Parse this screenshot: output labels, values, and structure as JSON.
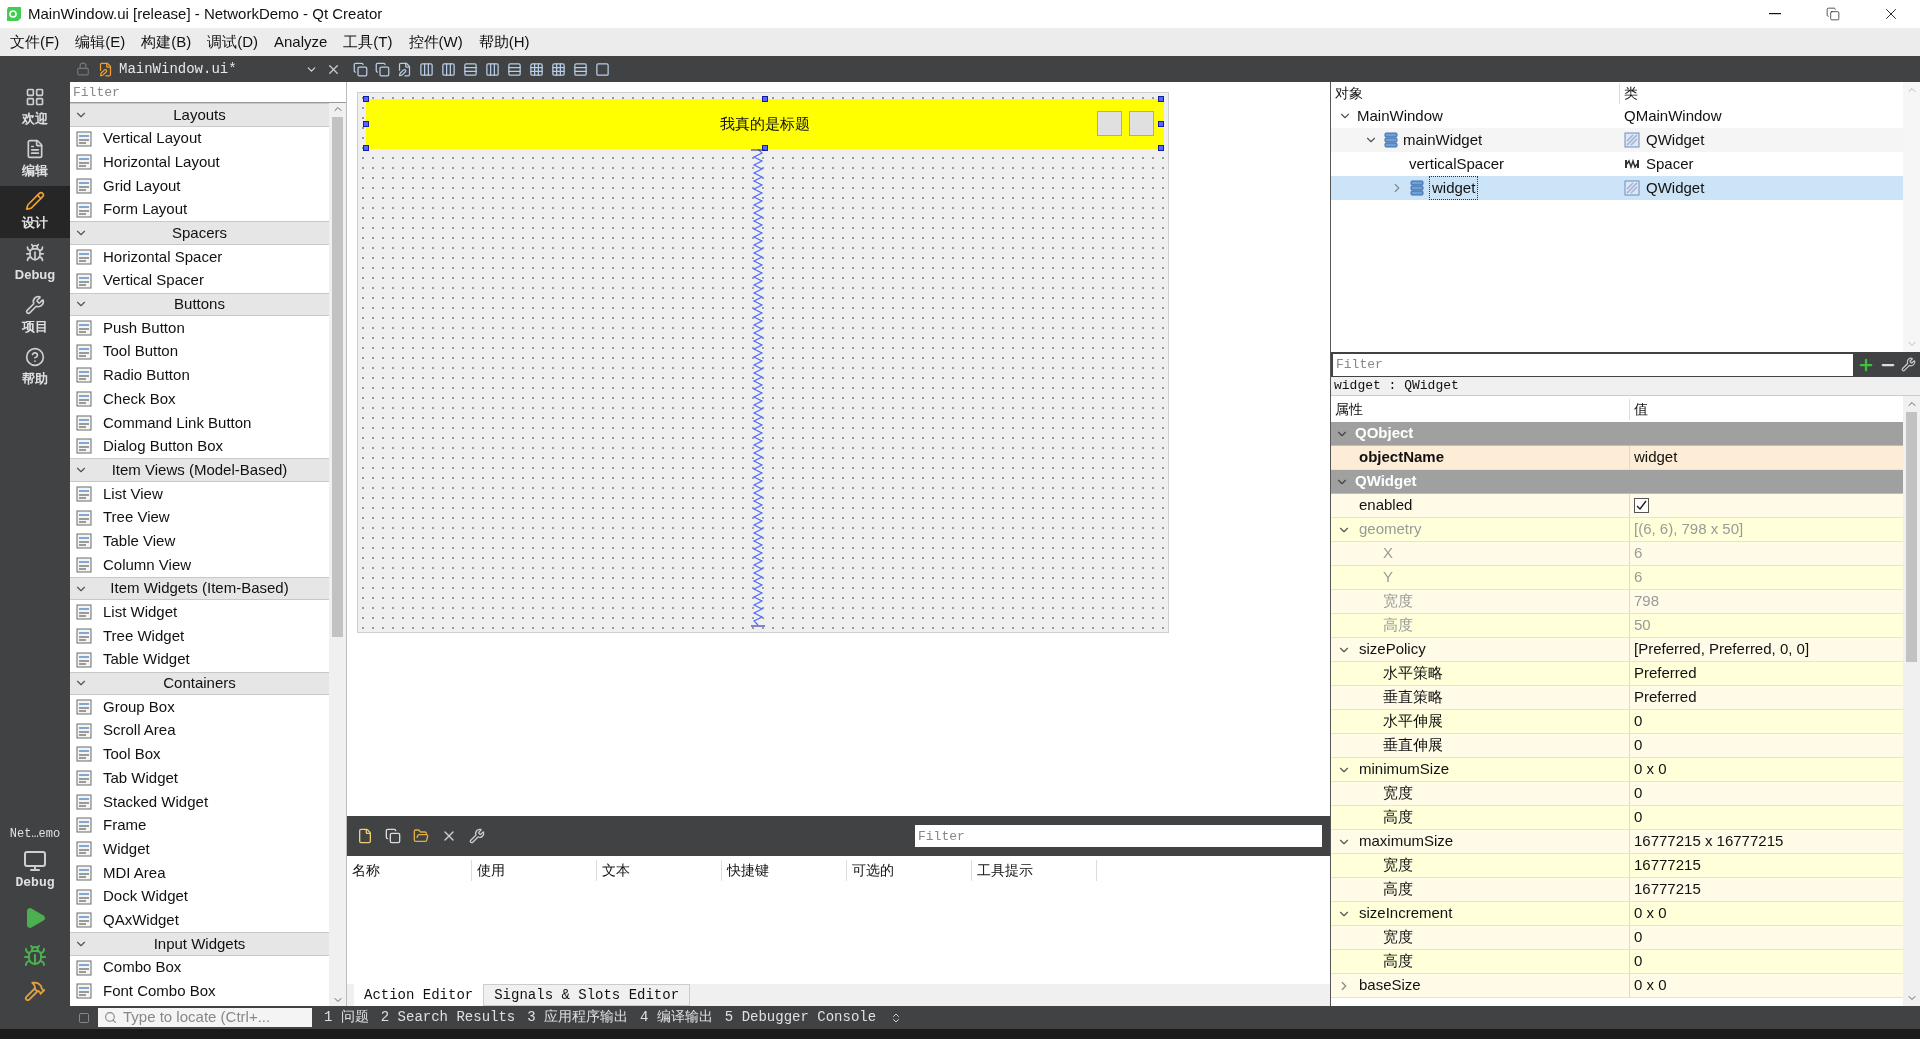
{
  "window": {
    "title": "MainWindow.ui [release] - NetworkDemo - Qt Creator"
  },
  "menu": [
    "文件(F)",
    "编辑(E)",
    "构建(B)",
    "调试(D)",
    "Analyze",
    "工具(T)",
    "控件(W)",
    "帮助(H)"
  ],
  "editor_tab": {
    "label": "MainWindow.ui*"
  },
  "modes": [
    {
      "label": "欢迎",
      "selected": false
    },
    {
      "label": "编辑",
      "selected": false
    },
    {
      "label": "设计",
      "selected": true
    },
    {
      "label": "Debug",
      "selected": false
    },
    {
      "label": "项目",
      "selected": false
    },
    {
      "label": "帮助",
      "selected": false
    }
  ],
  "run_target": {
    "project": "Net…emo",
    "config": "Debug"
  },
  "widget_box": {
    "filter_placeholder": "Filter",
    "categories": [
      {
        "name": "Layouts",
        "expanded": true,
        "items": [
          "Vertical Layout",
          "Horizontal Layout",
          "Grid Layout",
          "Form Layout"
        ]
      },
      {
        "name": "Spacers",
        "expanded": true,
        "items": [
          "Horizontal Spacer",
          "Vertical Spacer"
        ]
      },
      {
        "name": "Buttons",
        "expanded": true,
        "items": [
          "Push Button",
          "Tool Button",
          "Radio Button",
          "Check Box",
          "Command Link Button",
          "Dialog Button Box"
        ]
      },
      {
        "name": "Item Views (Model-Based)",
        "expanded": true,
        "items": [
          "List View",
          "Tree View",
          "Table View",
          "Column View"
        ]
      },
      {
        "name": "Item Widgets (Item-Based)",
        "expanded": true,
        "items": [
          "List Widget",
          "Tree Widget",
          "Table Widget"
        ]
      },
      {
        "name": "Containers",
        "expanded": true,
        "items": [
          "Group Box",
          "Scroll Area",
          "Tool Box",
          "Tab Widget",
          "Stacked Widget",
          "Frame",
          "Widget",
          "MDI Area",
          "Dock Widget",
          "QAxWidget"
        ]
      },
      {
        "name": "Input Widgets",
        "expanded": true,
        "items": [
          "Combo Box",
          "Font Combo Box"
        ]
      }
    ]
  },
  "form": {
    "title": "我真的是标题"
  },
  "action_editor": {
    "filter_placeholder": "Filter",
    "columns": [
      "名称",
      "使用",
      "文本",
      "快捷键",
      "可选的",
      "工具提示"
    ],
    "tabs": [
      {
        "label": "Action Editor",
        "selected": true
      },
      {
        "label": "Signals & Slots Editor",
        "selected": false
      }
    ]
  },
  "object_inspector": {
    "columns": [
      "对象",
      "类"
    ],
    "tree": [
      {
        "name": "MainWindow",
        "class": "QMainWindow",
        "expanded": true,
        "selected": false,
        "children": [
          {
            "name": "mainWidget",
            "class": "QWidget",
            "kind": "layout-widget",
            "expanded": true,
            "selected": false,
            "children": [
              {
                "name": "verticalSpacer",
                "class": "Spacer",
                "kind": "spacer",
                "selected": false
              },
              {
                "name": "widget",
                "class": "QWidget",
                "kind": "layout-widget",
                "expanded": false,
                "selected": true
              }
            ]
          }
        ]
      }
    ]
  },
  "property_editor": {
    "filter_placeholder": "Filter",
    "object_label": "widget : QWidget",
    "columns": [
      "属性",
      "值"
    ],
    "groups": [
      {
        "name": "QObject",
        "expanded": true,
        "properties": [
          {
            "name": "objectName",
            "value": "widget",
            "modified": true
          }
        ]
      },
      {
        "name": "QWidget",
        "expanded": true,
        "properties": [
          {
            "name": "enabled",
            "kind": "checkbox",
            "checked": true
          },
          {
            "name": "geometry",
            "value": "[(6, 6), 798 x 50]",
            "disabled": true,
            "expanded": true,
            "children": [
              {
                "name": "X",
                "value": "6",
                "disabled": true
              },
              {
                "name": "Y",
                "value": "6",
                "disabled": true
              },
              {
                "name": "宽度",
                "value": "798",
                "disabled": true
              },
              {
                "name": "高度",
                "value": "50",
                "disabled": true
              }
            ]
          },
          {
            "name": "sizePolicy",
            "value": "[Preferred, Preferred, 0, 0]",
            "expanded": true,
            "children": [
              {
                "name": "水平策略",
                "value": "Preferred"
              },
              {
                "name": "垂直策略",
                "value": "Preferred"
              },
              {
                "name": "水平伸展",
                "value": "0"
              },
              {
                "name": "垂直伸展",
                "value": "0"
              }
            ]
          },
          {
            "name": "minimumSize",
            "value": "0 x 0",
            "expanded": true,
            "children": [
              {
                "name": "宽度",
                "value": "0"
              },
              {
                "name": "高度",
                "value": "0"
              }
            ]
          },
          {
            "name": "maximumSize",
            "value": "16777215 x 16777215",
            "expanded": true,
            "children": [
              {
                "name": "宽度",
                "value": "16777215"
              },
              {
                "name": "高度",
                "value": "16777215"
              }
            ]
          },
          {
            "name": "sizeIncrement",
            "value": "0 x 0",
            "expanded": true,
            "children": [
              {
                "name": "宽度",
                "value": "0"
              },
              {
                "name": "高度",
                "value": "0"
              }
            ]
          },
          {
            "name": "baseSize",
            "value": "0 x 0",
            "expanded": false
          }
        ]
      }
    ]
  },
  "status_bar": {
    "locator_placeholder": "Type to locate (Ctrl+...",
    "outputs": [
      "1 问题",
      "2 Search Results",
      "3 应用程序输出",
      "4 编译输出",
      "5 Debugger Console"
    ]
  }
}
